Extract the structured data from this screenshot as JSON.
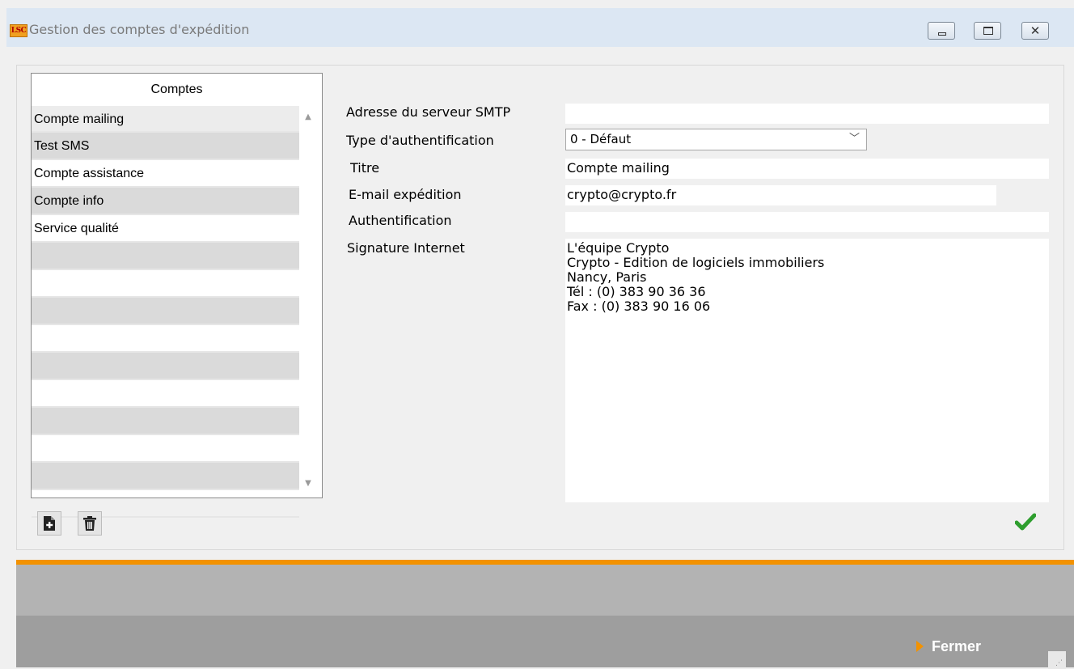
{
  "window": {
    "app_icon_text": "LSC",
    "title": "Gestion des comptes d'expédition",
    "controls": {
      "minimize": "minimize",
      "maximize": "maximize",
      "close": "close"
    }
  },
  "accounts": {
    "header": "Comptes",
    "items": [
      {
        "label": "Compte mailing"
      },
      {
        "label": "Test SMS"
      },
      {
        "label": "Compte assistance"
      },
      {
        "label": "Compte info"
      },
      {
        "label": "Service qualité"
      },
      {
        "label": ""
      },
      {
        "label": ""
      },
      {
        "label": ""
      },
      {
        "label": ""
      },
      {
        "label": ""
      },
      {
        "label": ""
      },
      {
        "label": ""
      },
      {
        "label": ""
      },
      {
        "label": ""
      },
      {
        "label": ""
      }
    ]
  },
  "toolbar": {
    "add_icon": "add-document-icon",
    "delete_icon": "trash-icon"
  },
  "form": {
    "smtp_label": "Adresse du serveur SMTP",
    "smtp_value": "",
    "auth_type_label": "Type d'authentification",
    "auth_type_value": "0 - Défaut",
    "titre_label": "Titre",
    "titre_value": "Compte mailing",
    "email_label": "E-mail expédition",
    "email_value": "crypto@crypto.fr",
    "auth_label": "Authentification",
    "auth_value": "",
    "signature_label": "Signature Internet",
    "signature_value": "L'équipe Crypto\nCrypto - Edition de logiciels immobiliers\nNancy, Paris\nTél : (0) 383 90 36 36\nFax : (0) 383 90 16 06"
  },
  "colors": {
    "accent": "#f39200",
    "check": "#2e9e2e",
    "title_bar": "#dce7f3"
  },
  "footer": {
    "close_label": "Fermer"
  }
}
